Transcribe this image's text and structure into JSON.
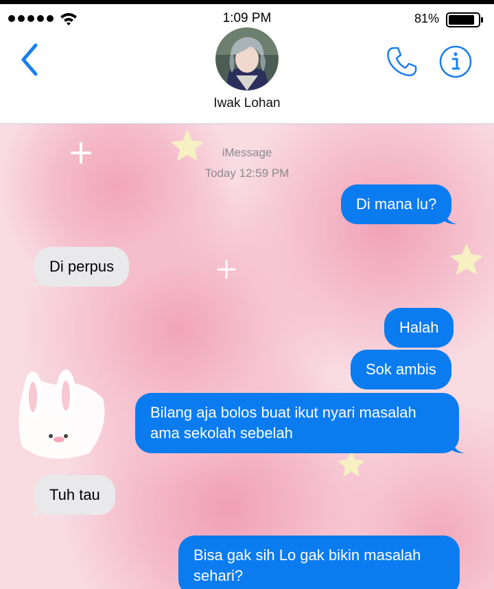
{
  "status_bar": {
    "time": "1:09 PM",
    "battery_percent": "81%"
  },
  "header": {
    "contact_name": "Iwak Lohan"
  },
  "chat": {
    "service_label": "iMessage",
    "timestamp": "Today 12:59 PM",
    "messages": [
      {
        "direction": "sent",
        "text": "Di mana lu?"
      },
      {
        "direction": "received",
        "text": "Di perpus"
      },
      {
        "direction": "sent",
        "text": "Halah"
      },
      {
        "direction": "sent",
        "text": "Sok ambis"
      },
      {
        "direction": "sent",
        "text": "Bilang aja bolos buat ikut nyari masalah ama sekolah sebelah"
      },
      {
        "direction": "received",
        "text": "Tuh tau"
      },
      {
        "direction": "sent",
        "text": "Bisa gak sih Lo gak bikin masalah sehari?"
      }
    ]
  },
  "icons": [
    "back-chevron-icon",
    "phone-icon",
    "info-icon",
    "wifi-icon",
    "battery-icon",
    "signal-icon"
  ],
  "colors": {
    "sent_bubble": "#0b7cf0",
    "received_bubble": "#e9e9eb",
    "ios_blue": "#1a7ef0"
  }
}
